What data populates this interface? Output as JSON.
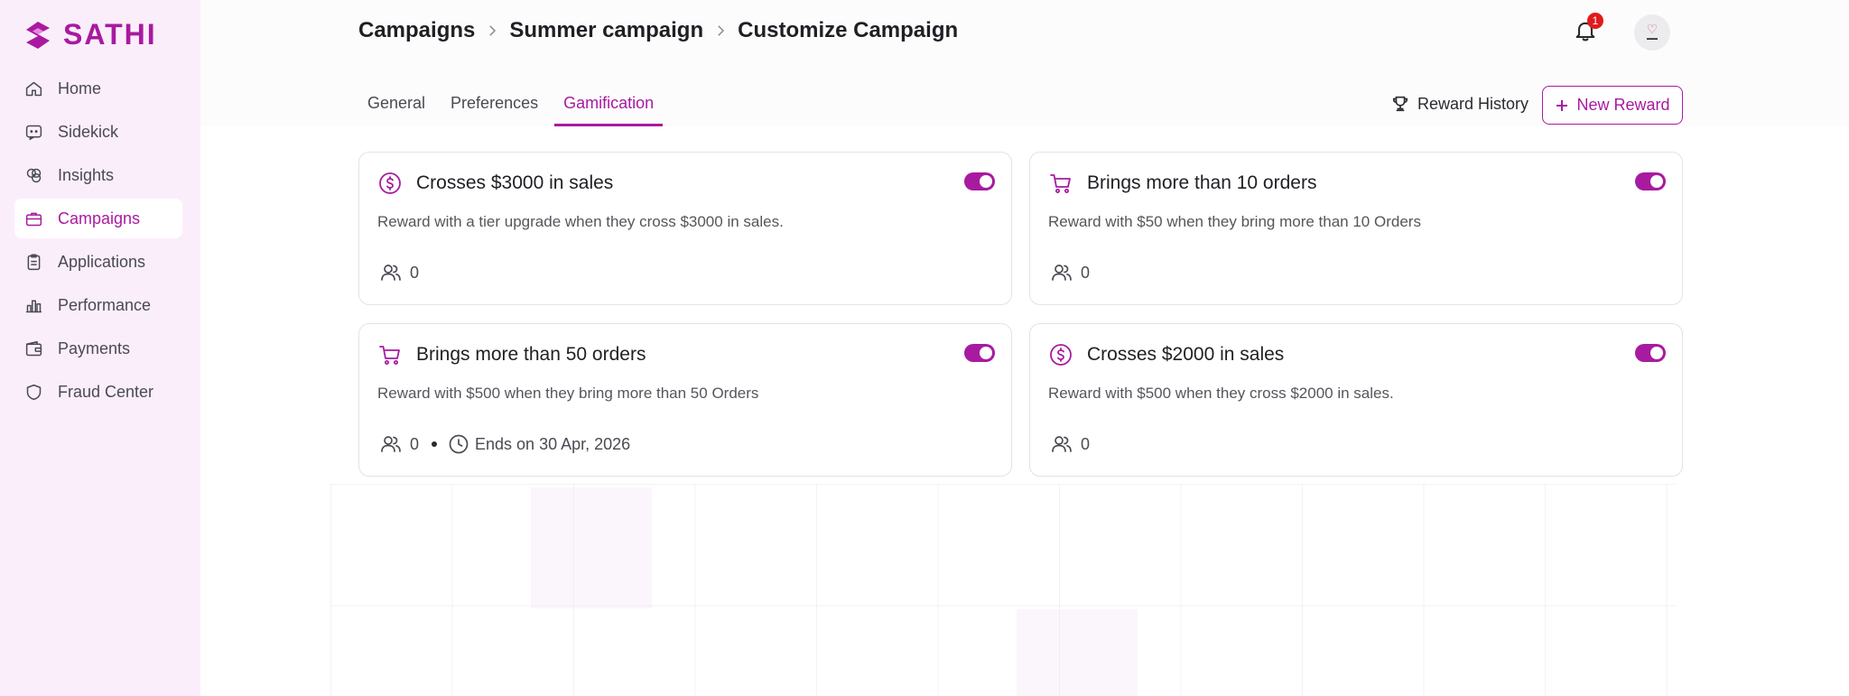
{
  "app": {
    "name": "SATHI",
    "accent": "#a81aa0"
  },
  "sidebar": {
    "items": [
      {
        "label": "Home",
        "icon": "home-icon"
      },
      {
        "label": "Sidekick",
        "icon": "chat-icon"
      },
      {
        "label": "Insights",
        "icon": "insights-icon"
      },
      {
        "label": "Campaigns",
        "icon": "briefcase-icon",
        "active": true
      },
      {
        "label": "Applications",
        "icon": "clipboard-icon"
      },
      {
        "label": "Performance",
        "icon": "bar-chart-icon"
      },
      {
        "label": "Payments",
        "icon": "wallet-icon"
      },
      {
        "label": "Fraud Center",
        "icon": "shield-icon"
      }
    ]
  },
  "header": {
    "breadcrumb": [
      "Campaigns",
      "Summer campaign",
      "Customize Campaign"
    ],
    "notification_count": "1"
  },
  "tabs": [
    "General",
    "Preferences",
    "Gamification"
  ],
  "active_tab": "Gamification",
  "actions": {
    "reward_history": "Reward History",
    "new_reward": "New Reward"
  },
  "cards": [
    {
      "title": "Crosses $3000 in sales",
      "description": "Reward with a tier upgrade when they cross $3000 in sales.",
      "count": "0",
      "icon": "dollar-circle-icon",
      "enabled": true
    },
    {
      "title": "Brings more than 10 orders",
      "description": "Reward with $50 when they bring more than 10 Orders",
      "count": "0",
      "icon": "cart-icon",
      "enabled": true
    },
    {
      "title": "Brings more than 50 orders",
      "description": "Reward with $500 when they bring more than 50 Orders",
      "count": "0",
      "icon": "cart-icon",
      "enabled": true,
      "end_text": "Ends on 30 Apr, 2026"
    },
    {
      "title": "Crosses $2000 in sales",
      "description": "Reward with $500 when they cross $2000 in sales.",
      "count": "0",
      "icon": "dollar-circle-icon",
      "enabled": true
    }
  ]
}
